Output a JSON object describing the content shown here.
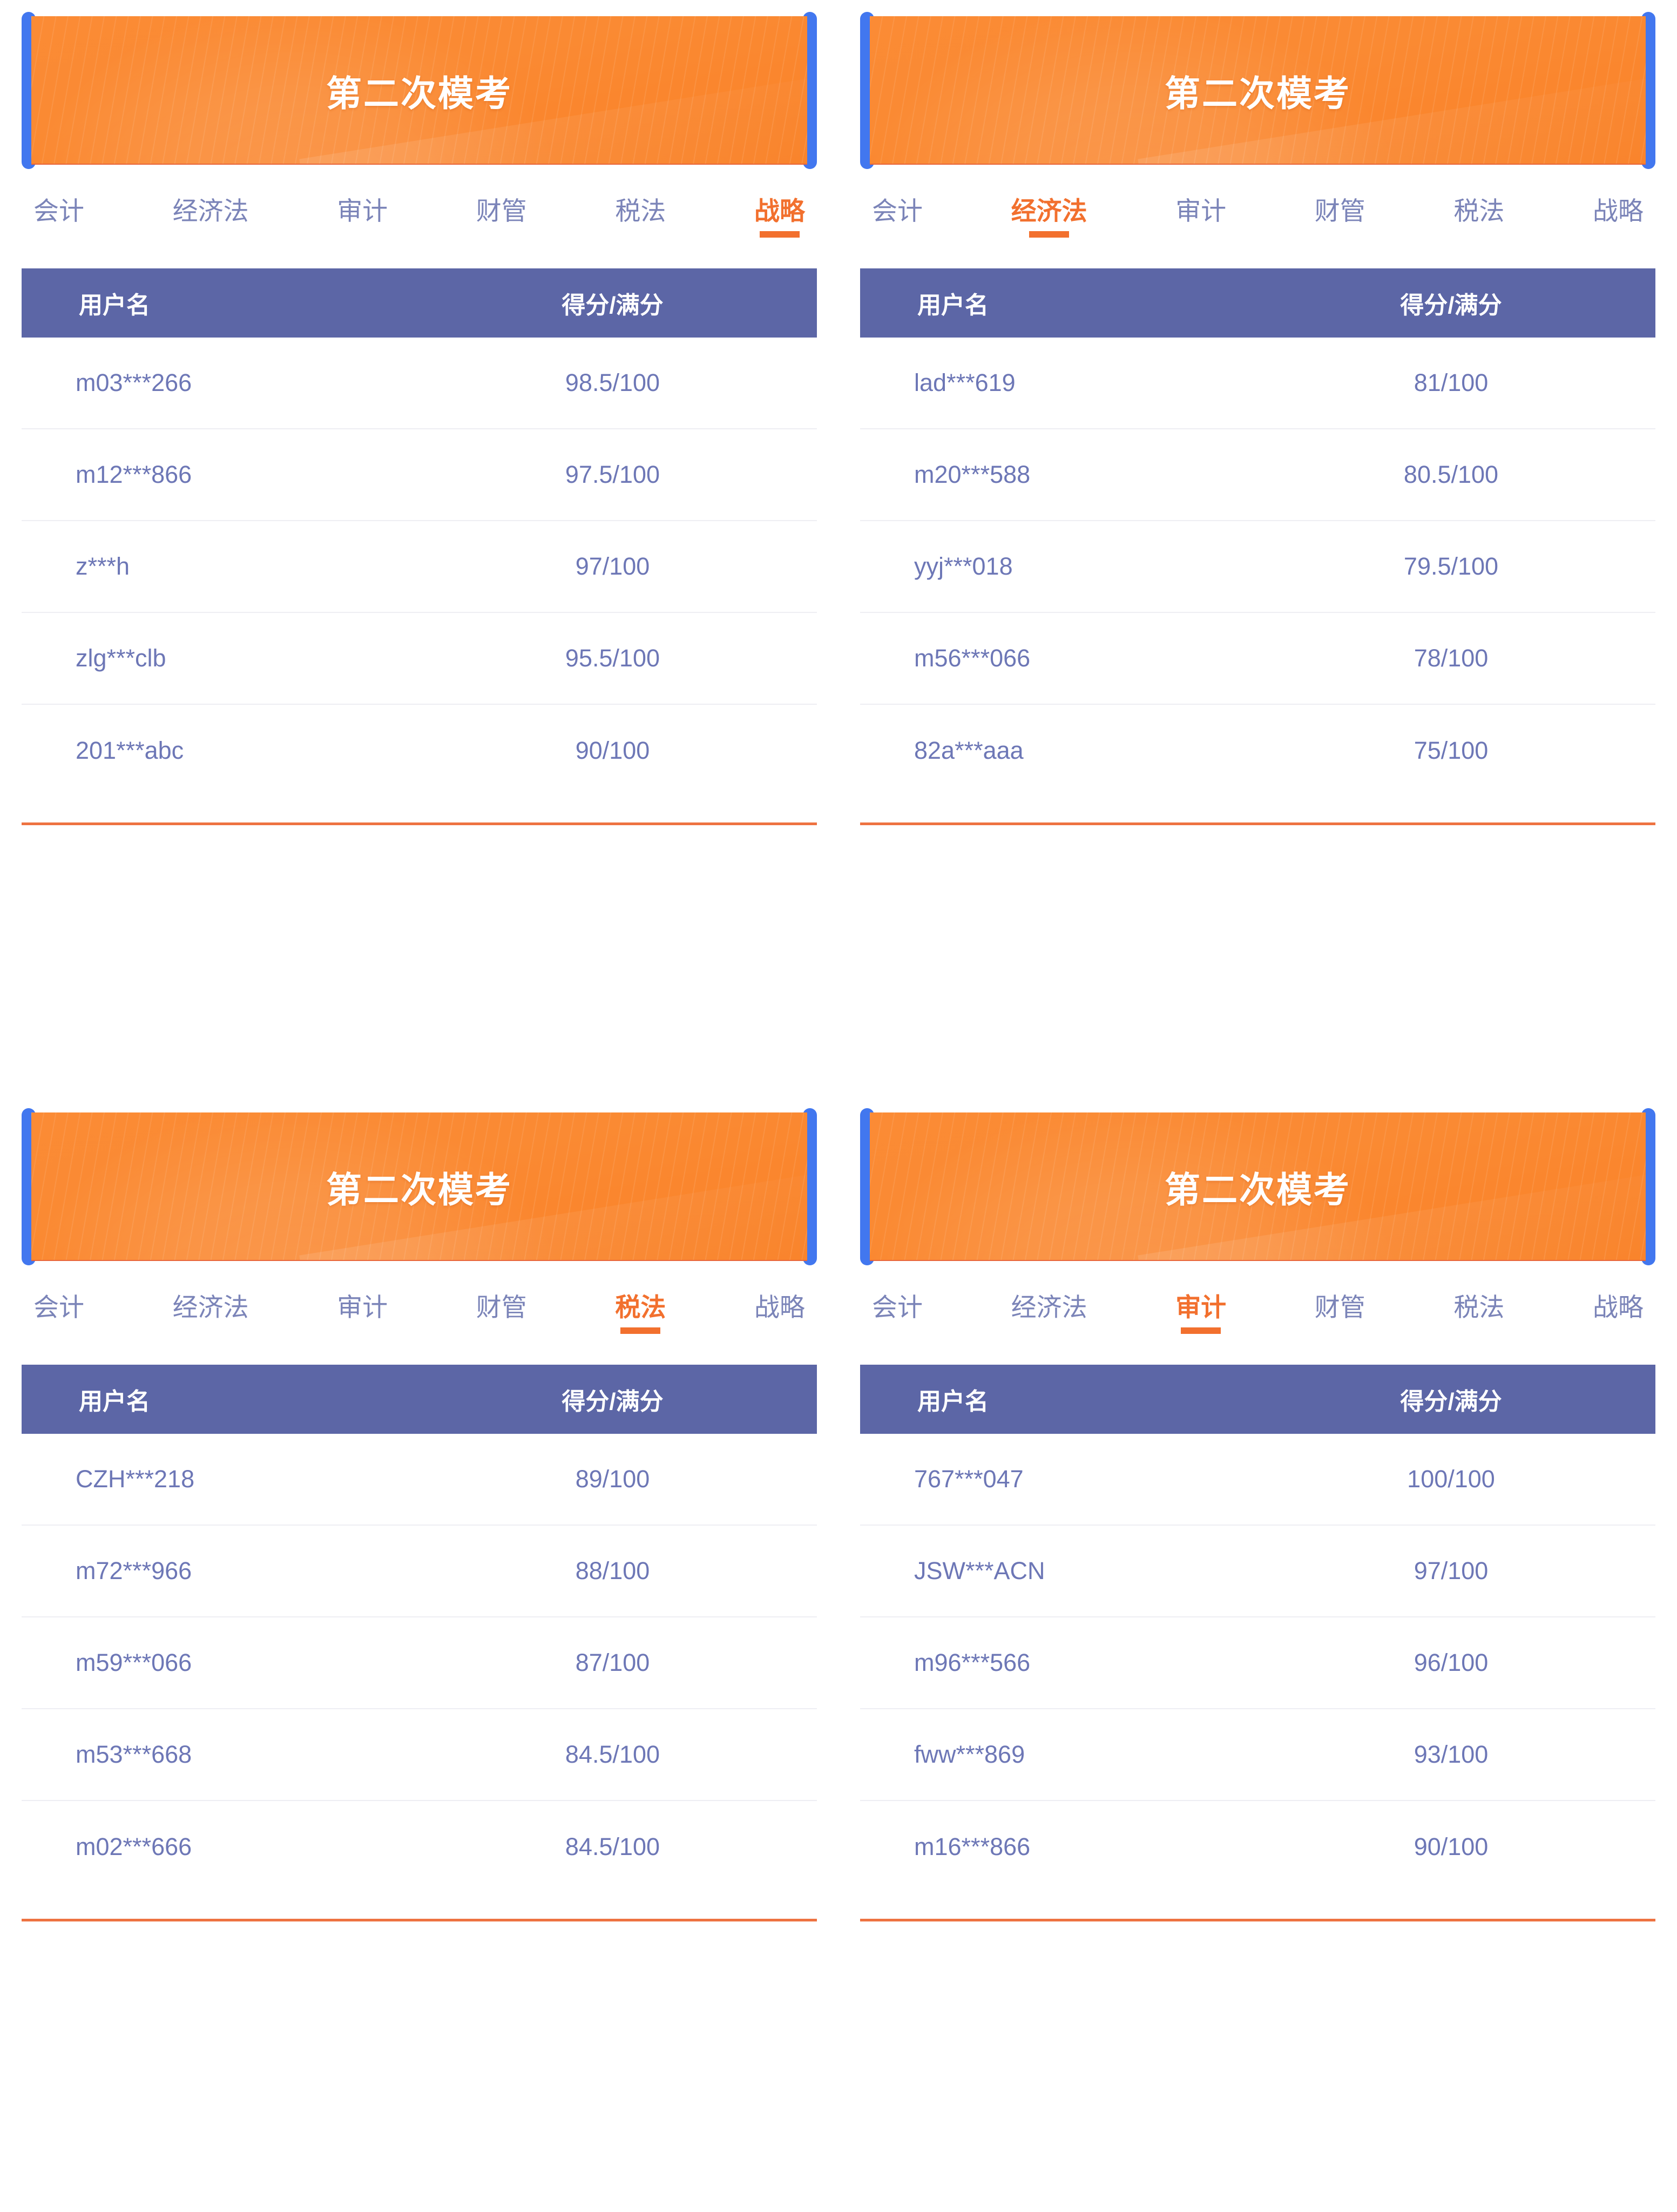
{
  "colors": {
    "banner_orange": "#fa8a33",
    "banner_accent_blue": "#4277ef",
    "table_header_blue": "#5c66a6",
    "row_text": "#6d77b6",
    "tab_inactive": "#7b84b8",
    "tab_active": "#f2702e",
    "footer_line": "#ee7341"
  },
  "table_headers": {
    "username": "用户名",
    "score": "得分/满分"
  },
  "panels": [
    {
      "banner_title": "第二次模考",
      "tabs": [
        "会计",
        "经济法",
        "审计",
        "财管",
        "税法",
        "战略"
      ],
      "active_tab": "战略",
      "active_tab_index": 5,
      "rows": [
        {
          "username": "m03***266",
          "score": "98.5/100"
        },
        {
          "username": "m12***866",
          "score": "97.5/100"
        },
        {
          "username": "z***h",
          "score": "97/100"
        },
        {
          "username": "zlg***clb",
          "score": "95.5/100"
        },
        {
          "username": "201***abc",
          "score": "90/100"
        }
      ]
    },
    {
      "banner_title": "第二次模考",
      "tabs": [
        "会计",
        "经济法",
        "审计",
        "财管",
        "税法",
        "战略"
      ],
      "active_tab": "经济法",
      "active_tab_index": 1,
      "rows": [
        {
          "username": "lad***619",
          "score": "81/100"
        },
        {
          "username": "m20***588",
          "score": "80.5/100"
        },
        {
          "username": "yyj***018",
          "score": "79.5/100"
        },
        {
          "username": "m56***066",
          "score": "78/100"
        },
        {
          "username": "82a***aaa",
          "score": "75/100"
        }
      ]
    },
    {
      "banner_title": "第二次模考",
      "tabs": [
        "会计",
        "经济法",
        "审计",
        "财管",
        "税法",
        "战略"
      ],
      "active_tab": "税法",
      "active_tab_index": 4,
      "rows": [
        {
          "username": "CZH***218",
          "score": "89/100"
        },
        {
          "username": "m72***966",
          "score": "88/100"
        },
        {
          "username": "m59***066",
          "score": "87/100"
        },
        {
          "username": "m53***668",
          "score": "84.5/100"
        },
        {
          "username": "m02***666",
          "score": "84.5/100"
        }
      ]
    },
    {
      "banner_title": "第二次模考",
      "tabs": [
        "会计",
        "经济法",
        "审计",
        "财管",
        "税法",
        "战略"
      ],
      "active_tab": "审计",
      "active_tab_index": 2,
      "rows": [
        {
          "username": "767***047",
          "score": "100/100"
        },
        {
          "username": "JSW***ACN",
          "score": "97/100"
        },
        {
          "username": "m96***566",
          "score": "96/100"
        },
        {
          "username": "fww***869",
          "score": "93/100"
        },
        {
          "username": "m16***866",
          "score": "90/100"
        }
      ]
    }
  ]
}
